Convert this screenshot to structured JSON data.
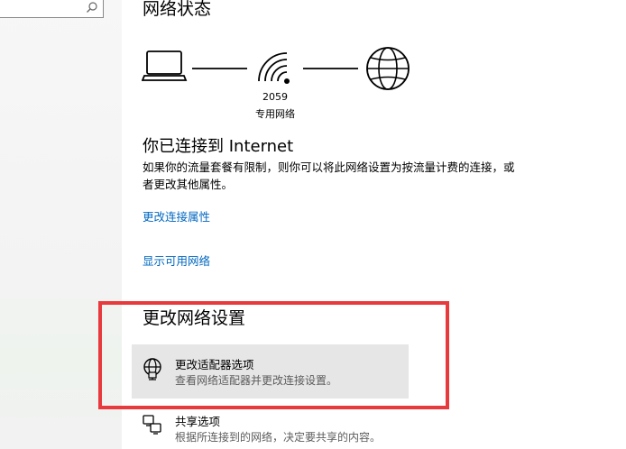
{
  "sidebar": {
    "search_icon": "search-icon"
  },
  "header": {
    "title": "网络状态"
  },
  "network": {
    "devices": [
      "laptop-icon",
      "wifi-icon",
      "globe-icon"
    ],
    "network_name": "2059",
    "network_type": "专用网络"
  },
  "status": {
    "title": "你已连接到 Internet",
    "description": "如果你的流量套餐有限制，则你可以将此网络设置为按流量计费的连接，或者更改其他属性。"
  },
  "links": {
    "change_connection_properties": "更改连接属性",
    "show_available_networks": "显示可用网络"
  },
  "change_settings": {
    "title": "更改网络设置",
    "options": [
      {
        "title": "更改适配器选项",
        "description": "查看网络适配器并更改连接设置。",
        "icon": "adapter-globe-icon"
      },
      {
        "title": "共享选项",
        "description": "根据所连接到的网络，决定要共享的内容。",
        "icon": "sharing-icon"
      }
    ]
  },
  "colors": {
    "link": "#0067c0",
    "highlight_box": "#e8393d",
    "hover_bg": "#e6e6e6"
  }
}
